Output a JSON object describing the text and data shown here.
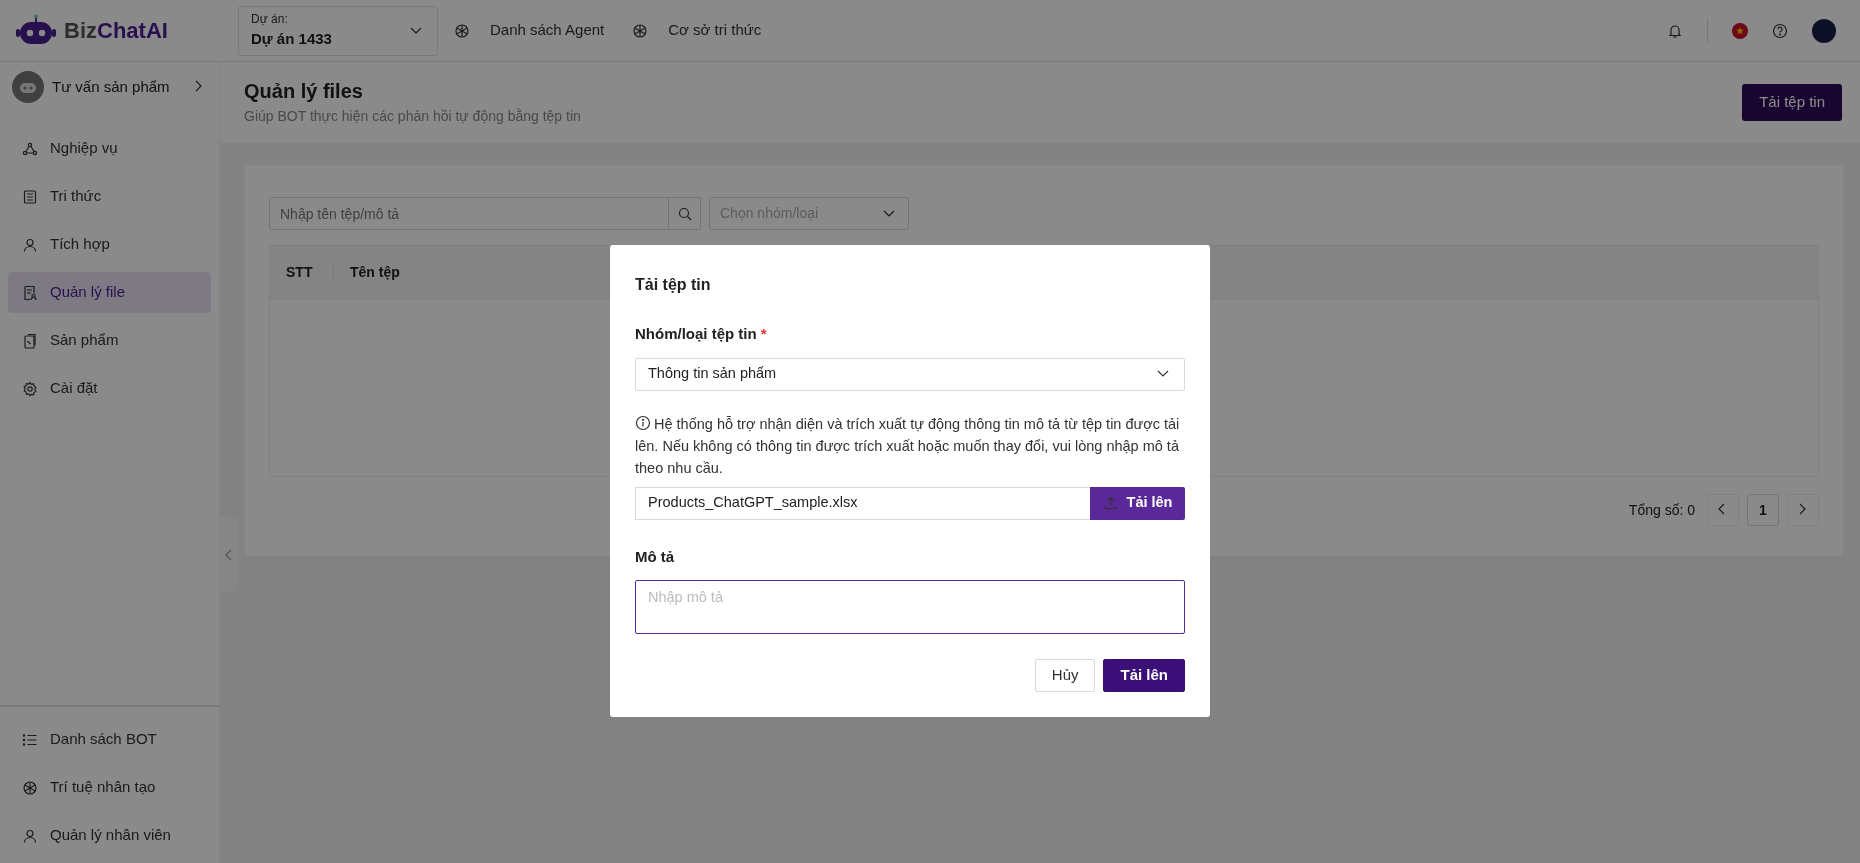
{
  "header": {
    "logo": {
      "prefix": "Biz",
      "name": "ChatAI"
    },
    "project": {
      "label": "Dự án:",
      "value": "Dự án 1433"
    },
    "nav": [
      {
        "label": "Danh sách Agent"
      },
      {
        "label": "Cơ sở tri thức"
      }
    ]
  },
  "sidebar": {
    "bot": {
      "name": "Tư vấn sản phẩm"
    },
    "items": [
      {
        "label": "Nghiệp vụ",
        "selected": false
      },
      {
        "label": "Tri thức",
        "selected": false
      },
      {
        "label": "Tích hợp",
        "selected": false
      },
      {
        "label": "Quản lý file",
        "selected": true
      },
      {
        "label": "Sản phẩm",
        "selected": false
      },
      {
        "label": "Cài đặt",
        "selected": false
      }
    ],
    "footer_items": [
      {
        "label": "Danh sách BOT"
      },
      {
        "label": "Trí tuệ nhân tạo"
      },
      {
        "label": "Quản lý nhân viên"
      }
    ]
  },
  "page": {
    "title": "Quản lý files",
    "subtitle": "Giúp BOT thực hiện các phản hồi tự động bằng tệp tin",
    "upload_button": "Tải tệp tin"
  },
  "filters": {
    "search_placeholder": "Nhập tên tệp/mô tả",
    "group_placeholder": "Chọn nhóm/loại"
  },
  "table": {
    "columns": [
      "STT",
      "Tên tệp"
    ]
  },
  "pagination": {
    "total_label": "Tổng số: 0",
    "pages": [
      {
        "label": "1",
        "selected": true
      }
    ]
  },
  "modal": {
    "title": "Tải tệp tin",
    "group_label": "Nhóm/loại tệp tin",
    "required_mark": "*",
    "group_value": "Thông tin sản phẩm",
    "info": "Hệ thống hỗ trợ nhận diện và trích xuất tự động thông tin mô tả từ tệp tin được tải lên. Nếu không có thông tin được trích xuất hoặc muốn thay đổi, vui lòng nhập mô tả theo nhu cầu.",
    "file_name": "Products_ChatGPT_sample.xlsx",
    "browse_button": "Tải lên",
    "description_label": "Mô tả",
    "description_placeholder": "Nhập mô tả",
    "buttons": [
      {
        "label": "Hủy",
        "kind": "secondary"
      },
      {
        "label": "Tải lên",
        "kind": "primary"
      }
    ]
  }
}
